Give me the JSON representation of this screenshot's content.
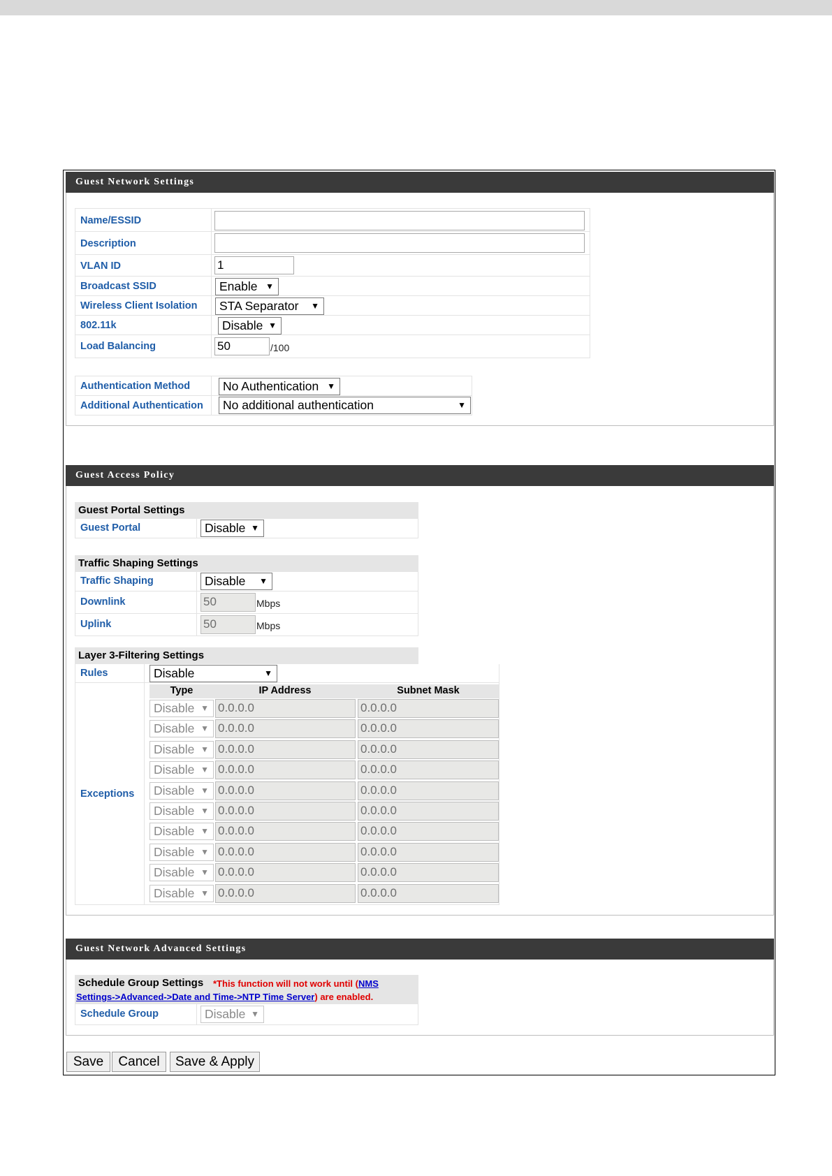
{
  "panels": {
    "network_title": "Guest Network Settings",
    "policy_title": "Guest Access Policy",
    "advanced_title": "Guest Network Advanced Settings"
  },
  "network": {
    "name_label": "Name/ESSID",
    "name_value": "",
    "description_label": "Description",
    "description_value": "",
    "vlan_label": "VLAN ID",
    "vlan_value": "1",
    "broadcast_label": "Broadcast SSID",
    "broadcast_value": "Enable",
    "isolation_label": "Wireless Client Isolation",
    "isolation_value": "STA Separator",
    "k_label": "802.11k",
    "k_value": "Disable",
    "lb_label": "Load Balancing",
    "lb_value": "50",
    "lb_unit": "/100",
    "auth_label": "Authentication Method",
    "auth_value": "No Authentication",
    "addauth_label": "Additional Authentication",
    "addauth_value": "No additional authentication"
  },
  "policy": {
    "portal_head": "Guest Portal Settings",
    "portal_label": "Guest Portal",
    "portal_value": "Disable",
    "traffic_head": "Traffic Shaping Settings",
    "traffic_label": "Traffic Shaping",
    "traffic_value": "Disable",
    "downlink_label": "Downlink",
    "downlink_value": "50",
    "uplink_label": "Uplink",
    "uplink_value": "50",
    "unit": "Mbps",
    "l3_head": "Layer 3-Filtering Settings",
    "rules_label": "Rules",
    "rules_value": "Disable",
    "exceptions_label": "Exceptions",
    "col_type": "Type",
    "col_ip": "IP Address",
    "col_mask": "Subnet Mask",
    "exceptions": [
      {
        "type": "Disable",
        "ip": "0.0.0.0",
        "mask": "0.0.0.0"
      },
      {
        "type": "Disable",
        "ip": "0.0.0.0",
        "mask": "0.0.0.0"
      },
      {
        "type": "Disable",
        "ip": "0.0.0.0",
        "mask": "0.0.0.0"
      },
      {
        "type": "Disable",
        "ip": "0.0.0.0",
        "mask": "0.0.0.0"
      },
      {
        "type": "Disable",
        "ip": "0.0.0.0",
        "mask": "0.0.0.0"
      },
      {
        "type": "Disable",
        "ip": "0.0.0.0",
        "mask": "0.0.0.0"
      },
      {
        "type": "Disable",
        "ip": "0.0.0.0",
        "mask": "0.0.0.0"
      },
      {
        "type": "Disable",
        "ip": "0.0.0.0",
        "mask": "0.0.0.0"
      },
      {
        "type": "Disable",
        "ip": "0.0.0.0",
        "mask": "0.0.0.0"
      },
      {
        "type": "Disable",
        "ip": "0.0.0.0",
        "mask": "0.0.0.0"
      }
    ]
  },
  "advanced": {
    "schedule_head": "Schedule Group Settings",
    "warn_prefix": "*This function will not work until (",
    "warn_link1": "NMS",
    "warn_link2": "Settings->Advanced->Date and Time->NTP Time Server",
    "warn_suffix": ") are enabled.",
    "schedule_label": "Schedule Group",
    "schedule_value": "Disable"
  },
  "buttons": {
    "save": "Save",
    "cancel": "Cancel",
    "save_apply": "Save & Apply"
  }
}
